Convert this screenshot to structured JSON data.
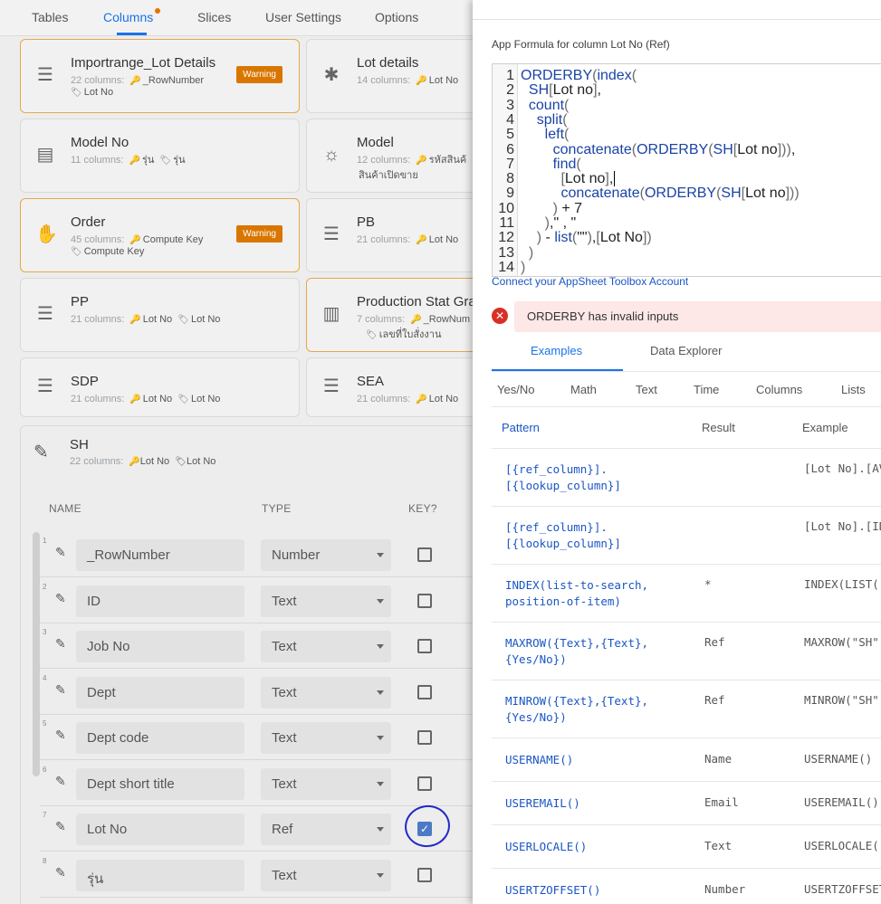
{
  "nav": {
    "tabs": [
      "Tables",
      "Columns",
      "Slices",
      "User Settings",
      "Options"
    ],
    "active": "Columns"
  },
  "tables": [
    {
      "title": "Importrange_Lot Details",
      "count": "22 columns:",
      "k1": "_RowNumber",
      "k2": "Lot No",
      "warning": "Warning",
      "icon": "table-icon"
    },
    {
      "title": "Lot details",
      "count": "14 columns:",
      "k1": "Lot No",
      "icon": "asterisk-icon"
    },
    {
      "title": "Model No",
      "count": "11 columns:",
      "k1": "รุ่น",
      "k2": "รุ่น",
      "icon": "building-icon"
    },
    {
      "title": "Model",
      "count": "12 columns:",
      "k1": "รหัสสินค้",
      "k2": "สินค้าเปิดขาย",
      "icon": "lightbulb-icon"
    },
    {
      "title": "Order",
      "count": "45 columns:",
      "k1": "Compute Key",
      "k2": "Compute Key",
      "warning": "Warning",
      "icon": "handshake-icon"
    },
    {
      "title": "PB",
      "count": "21 columns:",
      "k1": "Lot No",
      "icon": "table-icon"
    },
    {
      "title": "PP",
      "count": "21 columns:",
      "k1": "Lot No",
      "k2": "Lot No",
      "icon": "table-icon"
    },
    {
      "title": "Production Stat Gra",
      "count": "7 columns:",
      "k1": "_RowNum",
      "k2": "เลขที่ใบสั่งงาน",
      "icon": "bar-chart-icon"
    },
    {
      "title": "SDP",
      "count": "21 columns:",
      "k1": "Lot No",
      "k2": "Lot No",
      "icon": "table-icon"
    },
    {
      "title": "SEA",
      "count": "21 columns:",
      "k1": "Lot No",
      "icon": "table-icon"
    }
  ],
  "sh": {
    "title": "SH",
    "count": "22 columns:",
    "k1": "Lot No",
    "k2": "Lot No",
    "headers": {
      "name": "NAME",
      "type": "TYPE",
      "key": "KEY?"
    },
    "rows": [
      {
        "num": "1",
        "name": "_RowNumber",
        "type": "Number",
        "key": false
      },
      {
        "num": "2",
        "name": "ID",
        "type": "Text",
        "key": false
      },
      {
        "num": "3",
        "name": "Job No",
        "type": "Text",
        "key": false
      },
      {
        "num": "4",
        "name": "Dept",
        "type": "Text",
        "key": false
      },
      {
        "num": "5",
        "name": "Dept code",
        "type": "Text",
        "key": false
      },
      {
        "num": "6",
        "name": "Dept short title",
        "type": "Text",
        "key": false
      },
      {
        "num": "7",
        "name": "Lot No",
        "type": "Ref",
        "key": true
      },
      {
        "num": "8",
        "name": "รุ่น",
        "type": "Text",
        "key": false
      }
    ]
  },
  "panel": {
    "formula_label": "App Formula for column Lot No (Ref)",
    "line_numbers": [
      "1",
      "2",
      "3",
      "4",
      "5",
      "6",
      "7",
      "8",
      "9",
      "10",
      "11",
      "12",
      "13",
      "14"
    ],
    "code_lines": [
      "ORDERBY(index(",
      "  SH[Lot no],",
      "  count(",
      "    split(",
      "      left(",
      "        concatenate(ORDERBY(SH[Lot no])),",
      "        find(",
      "          [Lot no],",
      "          concatenate(ORDERBY(SH[Lot no]))",
      "        ) + 7",
      "      ),\" , \"",
      "    ) - list(\"\"),[Lot No])",
      "  )",
      ")"
    ],
    "connect_link": "Connect your AppSheet Toolbox Account",
    "error_text": "ORDERBY has invalid inputs",
    "tabs": [
      "Examples",
      "Data Explorer"
    ],
    "categories": [
      "Yes/No",
      "Math",
      "Text",
      "Time",
      "Columns",
      "Lists"
    ],
    "table_headers": [
      "Pattern",
      "Result",
      "Example"
    ],
    "examples": [
      {
        "pattern": "[{ref_column}].\n[{lookup_column}]",
        "result": "",
        "example": "[Lot No].[AV"
      },
      {
        "pattern": "[{ref_column}].\n[{lookup_column}]",
        "result": "",
        "example": "[Lot No].[ID"
      },
      {
        "pattern": "INDEX(list-to-search,\nposition-of-item)",
        "result": "*",
        "example": "INDEX(LIST("
      },
      {
        "pattern": "MAXROW({Text},{Text},\n{Yes/No})",
        "result": "Ref",
        "example": "MAXROW(\"SH\""
      },
      {
        "pattern": "MINROW({Text},{Text},\n{Yes/No})",
        "result": "Ref",
        "example": "MINROW(\"SH\""
      },
      {
        "pattern": "USERNAME()",
        "result": "Name",
        "example": "USERNAME()"
      },
      {
        "pattern": "USEREMAIL()",
        "result": "Email",
        "example": "USEREMAIL()"
      },
      {
        "pattern": "USERLOCALE()",
        "result": "Text",
        "example": "USERLOCALE("
      },
      {
        "pattern": "USERTZOFFSET()",
        "result": "Number",
        "example": "USERTZOFFSET"
      }
    ]
  }
}
